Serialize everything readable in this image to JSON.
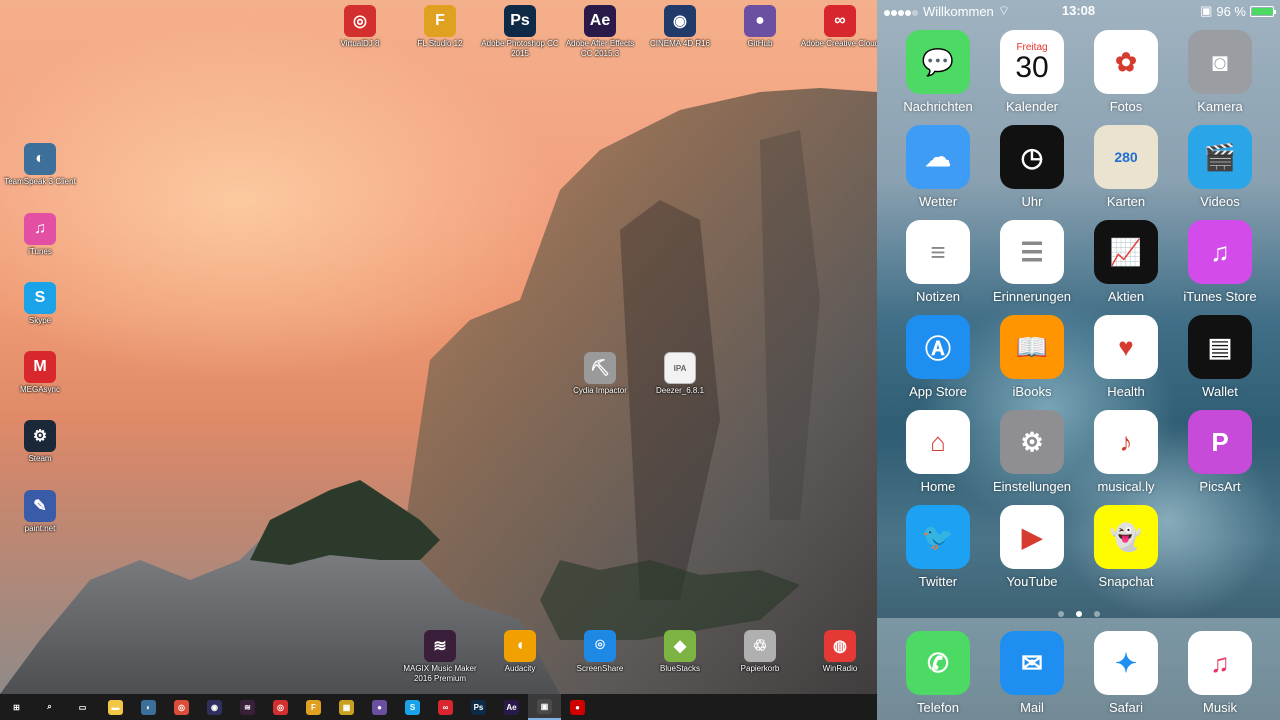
{
  "desktop": {
    "top_icons": [
      {
        "label": "VirtualDJ 8",
        "icon": "virtualdj-icon",
        "color": "#d32f2f",
        "glyph": "◎"
      },
      {
        "label": "FL Studio 12",
        "icon": "fl-studio-icon",
        "color": "#e0a020",
        "glyph": "F"
      },
      {
        "label": "Adobe Photoshop CC 2015",
        "icon": "photoshop-icon",
        "color": "#0e2a47",
        "glyph": "Ps"
      },
      {
        "label": "Adobe After Effects CC 2015.3",
        "icon": "after-effects-icon",
        "color": "#2a1a4a",
        "glyph": "Ae"
      },
      {
        "label": "CINEMA 4D R16",
        "icon": "cinema4d-icon",
        "color": "#203a6a",
        "glyph": "◉"
      },
      {
        "label": "GitHub",
        "icon": "github-icon",
        "color": "#6b4fa0",
        "glyph": "●"
      },
      {
        "label": "Adobe Creative Cloud",
        "icon": "creative-cloud-icon",
        "color": "#d8262e",
        "glyph": "∞"
      }
    ],
    "left_icons": [
      {
        "label": "TeamSpeak 3 Client",
        "icon": "teamspeak-icon",
        "color": "#3c6f99",
        "glyph": "◐"
      },
      {
        "label": "iTunes",
        "icon": "itunes-icon",
        "color": "#e24fa3",
        "glyph": "♫"
      },
      {
        "label": "Skype",
        "icon": "skype-icon",
        "color": "#1aa3e8",
        "glyph": "S"
      },
      {
        "label": "MEGAsync",
        "icon": "megasync-icon",
        "color": "#d9272e",
        "glyph": "M"
      },
      {
        "label": "Steam",
        "icon": "steam-icon",
        "color": "#1b2838",
        "glyph": "⚙"
      },
      {
        "label": "paint.net",
        "icon": "paintnet-icon",
        "color": "#3a5ca8",
        "glyph": "✎"
      }
    ],
    "center_icons": [
      {
        "label": "Cydia Impactor",
        "icon": "cydia-impactor-icon",
        "color": "#9a9a9a",
        "glyph": "⛏"
      },
      {
        "label": "Deezer_6.8.1",
        "icon": "ipa-file-icon",
        "color": "#f2f2f2",
        "glyph": "IPA"
      }
    ],
    "bottom_icons": [
      {
        "label": "MAGIX Music Maker 2016 Premium",
        "icon": "magix-icon",
        "color": "#3a1f3a",
        "glyph": "≋"
      },
      {
        "label": "Audacity",
        "icon": "audacity-icon",
        "color": "#f0a000",
        "glyph": "◖"
      },
      {
        "label": "ScreenShare",
        "icon": "screenshare-icon",
        "color": "#1e88e5",
        "glyph": "⌾"
      },
      {
        "label": "BlueStacks",
        "icon": "bluestacks-icon",
        "color": "#7cb342",
        "glyph": "◆"
      },
      {
        "label": "Papierkorb",
        "icon": "recycle-bin-icon",
        "color": "#b0b0b0",
        "glyph": "♲"
      },
      {
        "label": "WinRadio",
        "icon": "winradio-icon",
        "color": "#e53935",
        "glyph": "◍"
      }
    ]
  },
  "taskbar": {
    "items": [
      {
        "icon": "windows-start-icon",
        "color": "#ffffff",
        "glyph": "⊞",
        "active": false
      },
      {
        "icon": "search-icon",
        "color": "#1b1b1b",
        "glyph": "⌕",
        "active": false
      },
      {
        "icon": "task-view-icon",
        "color": "#1b1b1b",
        "glyph": "▭",
        "active": false
      },
      {
        "icon": "file-explorer-icon",
        "color": "#f2c744",
        "glyph": "▬",
        "active": false
      },
      {
        "icon": "teamspeak-icon",
        "color": "#3c6f99",
        "glyph": "◐",
        "active": false
      },
      {
        "icon": "chrome-icon",
        "color": "#dd4b39",
        "glyph": "◎",
        "active": false
      },
      {
        "icon": "obs-icon",
        "color": "#303060",
        "glyph": "◉",
        "active": false
      },
      {
        "icon": "magix-icon",
        "color": "#3a1f3a",
        "glyph": "≋",
        "active": false
      },
      {
        "icon": "virtualdj-icon",
        "color": "#d32f2f",
        "glyph": "◎",
        "active": false
      },
      {
        "icon": "fl-studio-icon",
        "color": "#e0a020",
        "glyph": "F",
        "active": false
      },
      {
        "icon": "winrar-icon",
        "color": "#c8a020",
        "glyph": "▦",
        "active": false
      },
      {
        "icon": "github-icon",
        "color": "#6b4fa0",
        "glyph": "●",
        "active": false
      },
      {
        "icon": "skype-icon",
        "color": "#1aa3e8",
        "glyph": "S",
        "active": false
      },
      {
        "icon": "creative-cloud-icon",
        "color": "#d8262e",
        "glyph": "∞",
        "active": false
      },
      {
        "icon": "photoshop-icon",
        "color": "#0e2a47",
        "glyph": "Ps",
        "active": false
      },
      {
        "icon": "after-effects-icon",
        "color": "#2a1a4a",
        "glyph": "Ae",
        "active": false
      },
      {
        "icon": "screenshare-window-icon",
        "color": "#4a4a4a",
        "glyph": "▣",
        "active": true
      },
      {
        "icon": "record-icon",
        "color": "#d00000",
        "glyph": "●",
        "active": false
      }
    ]
  },
  "phone": {
    "status": {
      "carrier": "Willkommen",
      "time": "13:08",
      "battery_label": "96 %",
      "battery_level": 0.96
    },
    "apps": [
      {
        "name": "Nachrichten",
        "icon": "messages-icon",
        "bg": "#4cd964",
        "glyph": "💬"
      },
      {
        "name": "Kalender",
        "icon": "calendar-icon",
        "bg": "#ffffff",
        "glyph": "30",
        "sub": "Freitag"
      },
      {
        "name": "Fotos",
        "icon": "photos-icon",
        "bg": "#ffffff",
        "glyph": "✿"
      },
      {
        "name": "Kamera",
        "icon": "camera-icon",
        "bg": "#9a9ea3",
        "glyph": "◙"
      },
      {
        "name": "Wetter",
        "icon": "weather-icon",
        "bg": "#3f9cf5",
        "glyph": "☁"
      },
      {
        "name": "Uhr",
        "icon": "clock-icon",
        "bg": "#111111",
        "glyph": "◷"
      },
      {
        "name": "Karten",
        "icon": "maps-icon",
        "bg": "#e9e3d0",
        "glyph": "280"
      },
      {
        "name": "Videos",
        "icon": "videos-icon",
        "bg": "#2aa6e8",
        "glyph": "🎬"
      },
      {
        "name": "Notizen",
        "icon": "notes-icon",
        "bg": "#ffffff",
        "glyph": "≡"
      },
      {
        "name": "Erinnerungen",
        "icon": "reminders-icon",
        "bg": "#ffffff",
        "glyph": "☰"
      },
      {
        "name": "Aktien",
        "icon": "stocks-icon",
        "bg": "#111111",
        "glyph": "📈"
      },
      {
        "name": "iTunes Store",
        "icon": "itunes-store-icon",
        "bg": "#d34bea",
        "glyph": "♫"
      },
      {
        "name": "App Store",
        "icon": "app-store-icon",
        "bg": "#1f8ef1",
        "glyph": "Ⓐ"
      },
      {
        "name": "iBooks",
        "icon": "ibooks-icon",
        "bg": "#ff9500",
        "glyph": "📖"
      },
      {
        "name": "Health",
        "icon": "health-icon",
        "bg": "#ffffff",
        "glyph": "♥"
      },
      {
        "name": "Wallet",
        "icon": "wallet-icon",
        "bg": "#111111",
        "glyph": "▤"
      },
      {
        "name": "Home",
        "icon": "home-icon",
        "bg": "#ffffff",
        "glyph": "⌂"
      },
      {
        "name": "Einstellungen",
        "icon": "settings-icon",
        "bg": "#8e8e93",
        "glyph": "⚙"
      },
      {
        "name": "musical.ly",
        "icon": "musically-icon",
        "bg": "#ffffff",
        "glyph": "♪"
      },
      {
        "name": "PicsArt",
        "icon": "picsart-icon",
        "bg": "#c54bd8",
        "glyph": "P"
      },
      {
        "name": "Twitter",
        "icon": "twitter-icon",
        "bg": "#1da1f2",
        "glyph": "🐦"
      },
      {
        "name": "YouTube",
        "icon": "youtube-icon",
        "bg": "#ffffff",
        "glyph": "▶"
      },
      {
        "name": "Snapchat",
        "icon": "snapchat-icon",
        "bg": "#fffc00",
        "glyph": "👻"
      }
    ],
    "dock": [
      {
        "name": "Telefon",
        "icon": "phone-icon",
        "bg": "#4cd964",
        "glyph": "✆"
      },
      {
        "name": "Mail",
        "icon": "mail-icon",
        "bg": "#1f8ef1",
        "glyph": "✉"
      },
      {
        "name": "Safari",
        "icon": "safari-icon",
        "bg": "#ffffff",
        "glyph": "✦"
      },
      {
        "name": "Musik",
        "icon": "music-icon",
        "bg": "#ffffff",
        "glyph": "♫"
      }
    ],
    "page_indicator": {
      "pages": 3,
      "current": 2
    }
  }
}
